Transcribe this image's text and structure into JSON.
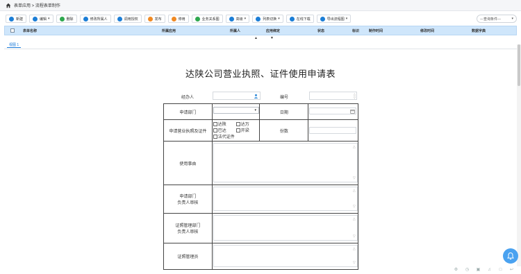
{
  "breadcrumb": {
    "text": "表单应用 > 流程表单制作"
  },
  "toolbar": {
    "buttons": [
      {
        "label": "新建",
        "color": "#1c7ed6"
      },
      {
        "label": "编辑",
        "color": "#1c7ed6",
        "caret": "▾"
      },
      {
        "label": "删除",
        "color": "#2fa84f"
      },
      {
        "label": "修改所属人",
        "color": "#1c7ed6"
      },
      {
        "label": "调用授权",
        "color": "#1c7ed6"
      },
      {
        "label": "发布",
        "color": "#f08a24"
      },
      {
        "label": "停用",
        "color": "#f08a24"
      },
      {
        "label": "业务关系图",
        "color": "#2fa84f"
      },
      {
        "label": "高级",
        "color": "#1c7ed6",
        "caret": "▾"
      },
      {
        "label": "列表切换",
        "color": "#1c7ed6",
        "caret": "▾"
      },
      {
        "label": "在线下载",
        "color": "#1c7ed6"
      },
      {
        "label": "导出流程图",
        "color": "#1c7ed6",
        "caret": "▾"
      }
    ],
    "query": "---查询条件---",
    "query_caret": "▾"
  },
  "grid": {
    "columns": [
      "表单名称",
      "所属应用",
      "所属人",
      "应用绑定",
      "状态",
      "标识",
      "制作时间",
      "修改时间",
      "数据字典"
    ]
  },
  "sort": {
    "asc": "▲",
    "desc": "▼"
  },
  "tabs": [
    "视图 1"
  ],
  "form": {
    "title": "达陕公司营业执照、证件使用申请表",
    "handler_label": "经办人",
    "number_label": "编号",
    "rows": {
      "dept_label": "申请部门",
      "date_label": "日期",
      "license_label": "申请营业执照及证件",
      "copies_label": "份数",
      "purpose_label": "使用事由",
      "dept_review_label_1": "申请部门",
      "dept_review_label_2": "负责人审核",
      "cert_dept_label_1": "证照管理部门",
      "cert_dept_label_2": "负责人审核",
      "cert_admin_label": "证照管理员"
    },
    "checkboxes": [
      "达陕",
      "达万",
      "巴达",
      "开梁",
      "法代证件"
    ]
  },
  "colors": {
    "accent": "#1a7ad9",
    "header_bg": "#cfe6fb",
    "fab": "#4aa2f0"
  }
}
